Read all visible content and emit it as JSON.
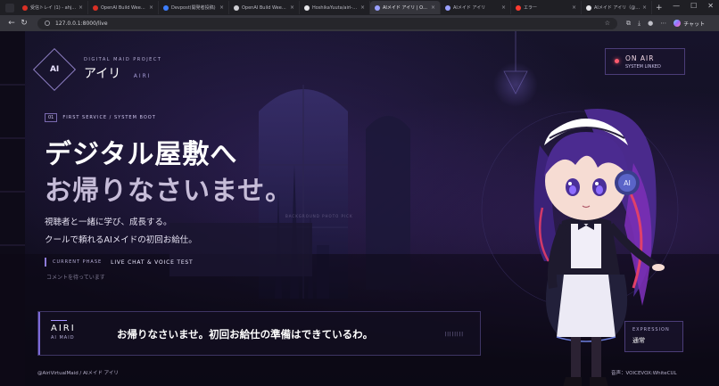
{
  "browser": {
    "tabs": [
      {
        "title": "受信トレイ (1) - ahjmaer...",
        "color": "#d93025",
        "active": false
      },
      {
        "title": "OpenAI Build Week: Yo...",
        "color": "#d93025",
        "active": false
      },
      {
        "title": "Devpost(開発者投稿)",
        "color": "#3d7eff",
        "active": false
      },
      {
        "title": "OpenAI Build Week概要",
        "color": "#cfcfd4",
        "active": false
      },
      {
        "title": "HoshikaYuuta/airi-ai-vi...",
        "color": "#e6e6ea",
        "active": false
      },
      {
        "title": "AIメイド アイリ | ON AIR",
        "color": "#9aa0ff",
        "active": true
      },
      {
        "title": "AIメイド アイリ",
        "color": "#9aa0ff",
        "active": false
      },
      {
        "title": "エラー",
        "color": "#ff3b30",
        "active": false
      },
      {
        "title": "AIメイド アイリ（@AiriVi...",
        "color": "#e6e6ea",
        "active": false
      }
    ],
    "url": "127.0.0.1:8000/live",
    "chat_label": "チャット"
  },
  "brand": {
    "logo_text": "AI",
    "subtitle": "DIGITAL MAID PROJECT",
    "name": "アイリ",
    "name_en": "AIRI"
  },
  "status": {
    "title": "ON AIR",
    "subtitle": "SYSTEM LINKED",
    "dot_color": "#ff5a6e"
  },
  "service": {
    "number": "01",
    "label": "FIRST SERVICE / SYSTEM BOOT"
  },
  "headline": {
    "line1": "デジタル屋敷へ",
    "line2": "お帰りなさいませ。"
  },
  "description": {
    "line1": "視聴者と一緒に学び、成長する。",
    "line2": "クールで頼れるAIメイドの初回お給仕。"
  },
  "phase": {
    "label": "CURRENT PHASE",
    "value": "LIVE CHAT & VOICE TEST",
    "comment": "コメントを待っています"
  },
  "dialog": {
    "speaker_en": "AIRI",
    "speaker_sub": "AI MAID",
    "text": "お帰りなさいませ。初回お給仕の準備はできているわ。",
    "bars": "||||||||"
  },
  "expression": {
    "label": "EXPRESSION",
    "value": "通常"
  },
  "watermark": "BACKGROUND PHOTO PICK",
  "footer": {
    "left": "@AiriVirtualMaid / AIメイド アイリ",
    "right": "音声：VOICEVOX:WhiteCUL"
  }
}
